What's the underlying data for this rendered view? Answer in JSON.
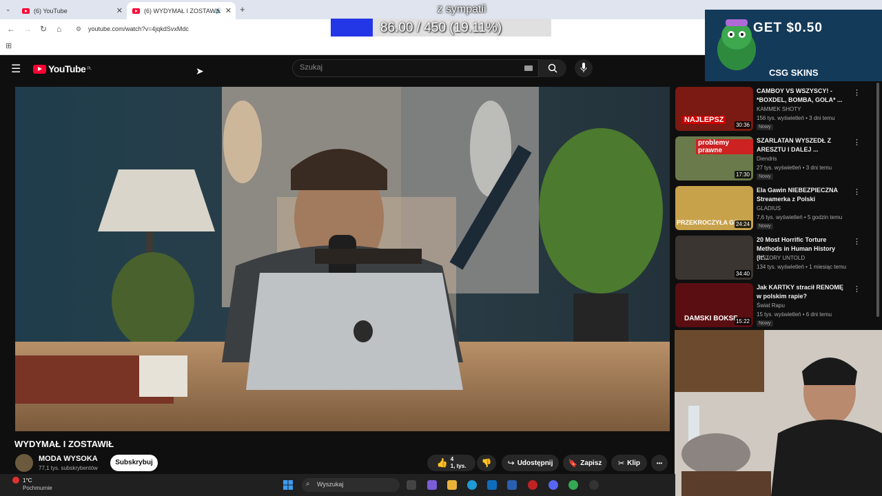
{
  "browser": {
    "tabs": [
      {
        "label": "(6) YouTube"
      },
      {
        "label": "(6) WYDYMAŁ I ZOSTAWIŁ"
      }
    ],
    "url": "youtube.com/watch?v=4jqkdSvxMdc"
  },
  "overlay": {
    "goal_title": "z sympatii",
    "goal_progress": "86.00 / 450 (19.11%)",
    "goal_fraction": 0.1911
  },
  "youtube": {
    "logo": "YouTube",
    "logo_region": "PL",
    "search_placeholder": "Szukaj"
  },
  "video": {
    "title": "WYDYMAŁ I ZOSTAWIŁ",
    "channel": "MODA WYSOKA",
    "subscribers": "77,1 tys. subskrybentów",
    "subscribe_label": "Subskrybuj",
    "likes_line1": "4",
    "likes_line2": "1,   tys.",
    "share_label": "Udostępnij",
    "save_label": "Zapisz",
    "clip_label": "Klip",
    "more_label": "•••"
  },
  "recommendations": [
    {
      "title": "CAMBOY VS WSZYSCY! - *BOXDEL, BOMBA, GOLA* ...",
      "channel": "KAMMEK SHOTY",
      "meta": "156 tys. wyświetleń • 3 dni temu",
      "badge": "Nowy",
      "duration": "30:36",
      "thumb_text": "NAJLEPSZ"
    },
    {
      "title": "SZARLATAN WYSZEDŁ Z ARESZTU I DALEJ ...",
      "channel": "Diendris",
      "meta": "27 tys. wyświetleń • 3 dni temu",
      "badge": "Nowy",
      "duration": "17:30",
      "thumb_text": "problemy prawne"
    },
    {
      "title": "Ela Gawin NIEBEZPIECZNA Streamerka z Polski",
      "channel": "GLADIUS",
      "meta": "7,6 tys. wyświetleń • 5 godzin temu",
      "badge": "Nowy",
      "duration": "24:24",
      "thumb_text": "PRZEKROCZYŁA GR"
    },
    {
      "title": "20 Most Horrific Torture Methods in Human History (It'...",
      "channel": "HISTORY UNTOLD",
      "meta": "134 tys. wyświetleń • 1 miesiąc temu",
      "badge": "",
      "duration": "34:40",
      "thumb_text": ""
    },
    {
      "title": "Jak KARTKY stracił RENOMĘ w polskim rapie?",
      "channel": "Świat Rapu",
      "meta": "15 tys. wyświetleń • 6 dni temu",
      "badge": "Nowy",
      "duration": "15:22",
      "thumb_text": "DAMSKI BOKSE"
    }
  ],
  "ad": {
    "headline": "GET $0.50",
    "brand": "CSG SKINS"
  },
  "taskbar": {
    "weather_temp": "1°C",
    "weather_desc": "Pochmurnie",
    "search_placeholder": "Wyszukaj"
  }
}
